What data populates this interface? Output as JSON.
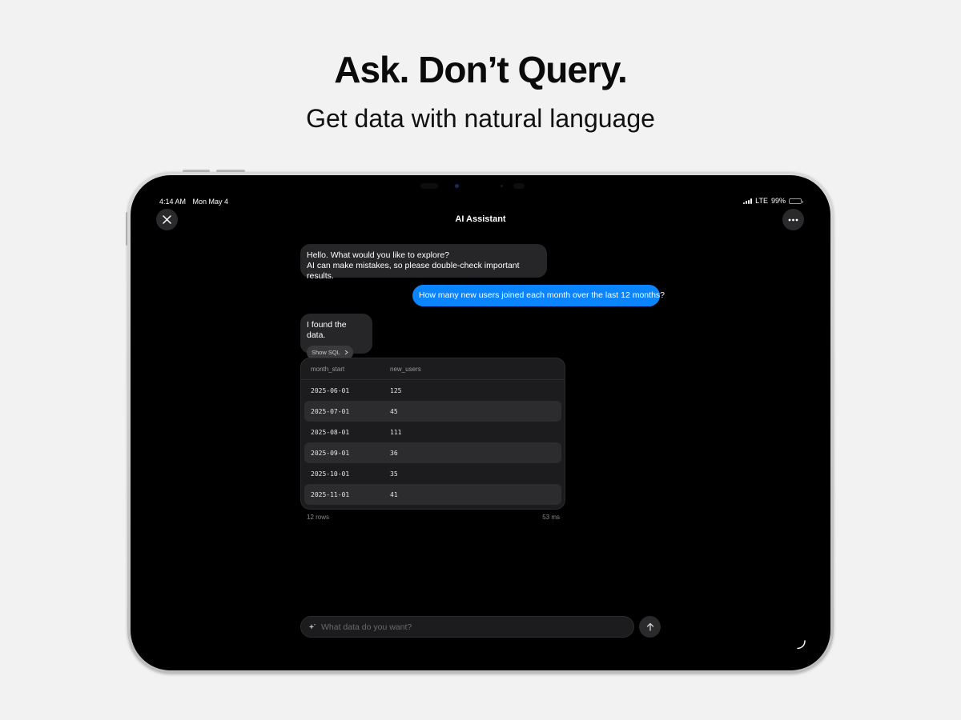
{
  "marketing": {
    "headline": "Ask. Don’t Query.",
    "subheadline": "Get data with natural language"
  },
  "status_bar": {
    "time": "4:14 AM",
    "date": "Mon May 4",
    "network": "LTE",
    "battery": "99%",
    "battery_level": 0.99
  },
  "nav": {
    "title": "AI Assistant",
    "close_icon": "close-icon",
    "more_icon": "ellipsis-icon"
  },
  "chat": {
    "greeting_line1": "Hello. What would you like to explore?",
    "greeting_line2": "AI can make mistakes, so please double-check important results.",
    "user_message": "How many new users joined each month over the last 12 months?",
    "response": "I found the data.",
    "show_sql_label": "Show SQL",
    "show_sql_icon": "chevron-right-icon"
  },
  "result_table": {
    "columns": [
      "month_start",
      "new_users"
    ],
    "rows": [
      [
        "2025-06-01",
        "125"
      ],
      [
        "2025-07-01",
        "45"
      ],
      [
        "2025-08-01",
        "111"
      ],
      [
        "2025-09-01",
        "36"
      ],
      [
        "2025-10-01",
        "35"
      ],
      [
        "2025-11-01",
        "41"
      ]
    ],
    "row_count": "12 rows",
    "duration": "53 ms"
  },
  "composer": {
    "placeholder": "What data do you want?",
    "sparkle_icon": "sparkle-icon",
    "send_icon": "arrow-up-icon"
  },
  "colors": {
    "user_bubble": "#0a84ff",
    "ai_bubble": "#262628",
    "screen_bg": "#000000",
    "page_bg": "#f2f2f2"
  }
}
